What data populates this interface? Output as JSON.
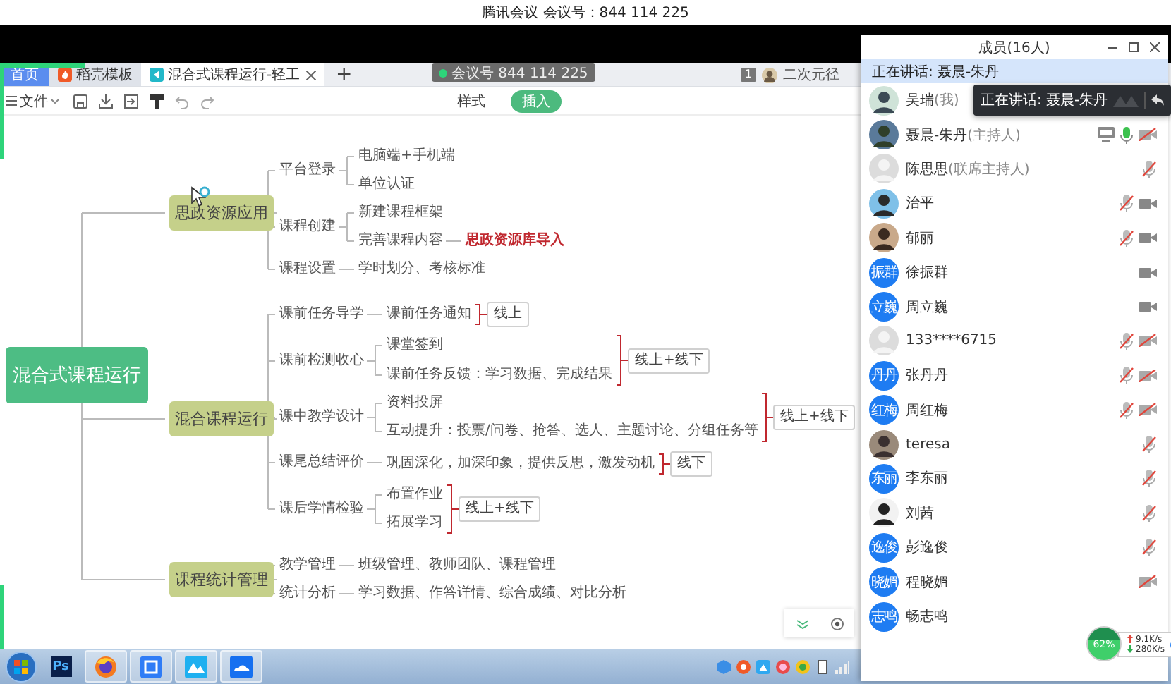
{
  "meeting_bar": {
    "title": "腾讯会议 会议号：844 114 225"
  },
  "meeting_badge": {
    "text": "会议号 844 114 225"
  },
  "tabs": [
    {
      "label": "首页",
      "selected": false,
      "kind": "home"
    },
    {
      "label": "稻壳模板",
      "selected": false,
      "kind": "template"
    },
    {
      "label": "混合式课程运行-轻工",
      "selected": true,
      "kind": "document"
    }
  ],
  "new_tab": "+",
  "account": {
    "badge": "1",
    "name": "二次元径"
  },
  "toolbar": {
    "menu": "文件",
    "ribbon_tabs": [
      {
        "label": "样式",
        "selected": false
      },
      {
        "label": "插入",
        "selected": true
      }
    ]
  },
  "mind_map": {
    "root": {
      "text": "混合式课程运行",
      "children": [
        {
          "text": "思政资源应用",
          "children": [
            {
              "text": "平台登录",
              "children": [
                {
                  "text": "电脑端+手机端"
                },
                {
                  "text": "单位认证"
                }
              ]
            },
            {
              "text": "课程创建",
              "children": [
                {
                  "text": "新建课程框架"
                },
                {
                  "text": "完善课程内容",
                  "children": [
                    {
                      "text": "思政资源库导入",
                      "emphasis": true
                    }
                  ]
                }
              ]
            },
            {
              "text": "课程设置",
              "children": [
                {
                  "text": "学时划分、考核标准"
                }
              ]
            }
          ]
        },
        {
          "text": "混合课程运行",
          "children": [
            {
              "text": "课前任务导学",
              "summary": "线上",
              "children": [
                {
                  "text": "课前任务通知"
                }
              ]
            },
            {
              "text": "课前检测收心",
              "summary": "线上+线下",
              "children": [
                {
                  "text": "课堂签到"
                },
                {
                  "text": "课前任务反馈：学习数据、完成结果"
                }
              ]
            },
            {
              "text": "课中教学设计",
              "summary": "线上+线下",
              "children": [
                {
                  "text": "资料投屏"
                },
                {
                  "text": "互动提升：投票/问卷、抢答、选人、主题讨论、分组任务等"
                }
              ]
            },
            {
              "text": "课尾总结评价",
              "summary": "线下",
              "children": [
                {
                  "text": "巩固深化，加深印象，提供反思，激发动机"
                }
              ]
            },
            {
              "text": "课后学情检验",
              "summary": "线上+线下",
              "children": [
                {
                  "text": "布置作业"
                },
                {
                  "text": "拓展学习"
                }
              ]
            }
          ]
        },
        {
          "text": "课程统计管理",
          "children": [
            {
              "text": "教学管理",
              "children": [
                {
                  "text": "班级管理、教师团队、课程管理"
                }
              ]
            },
            {
              "text": "统计分析",
              "children": [
                {
                  "text": "学习数据、作答详情、综合成绩、对比分析"
                }
              ]
            }
          ]
        }
      ]
    }
  },
  "members_panel": {
    "title": "成员(16人)",
    "speaking": "正在讲话: 聂晨-朱丹",
    "toast": "正在讲话: 聂晨-朱丹",
    "members": [
      {
        "name": "吴瑞",
        "role": "(我)",
        "avatar": {
          "kind": "photo"
        },
        "sharing": false
      },
      {
        "name": "聂晨-朱丹",
        "role": "(主持人)",
        "avatar": {
          "kind": "photo"
        },
        "sharing": true,
        "mic_on": true,
        "camera_on": false
      },
      {
        "name": "陈思思",
        "role": "(联席主持人)",
        "avatar": {
          "kind": "default"
        },
        "sharing": false,
        "mic_on": false
      },
      {
        "name": "治平",
        "avatar": {
          "kind": "photo"
        },
        "sharing": false,
        "mic_on": false,
        "camera_on": true
      },
      {
        "name": "郁丽",
        "avatar": {
          "kind": "photo"
        },
        "sharing": false,
        "mic_on": false,
        "camera_on": true
      },
      {
        "name": "徐振群",
        "avatar": {
          "kind": "initials",
          "text": "振群"
        },
        "sharing": false,
        "camera_on": true
      },
      {
        "name": "周立巍",
        "avatar": {
          "kind": "initials",
          "text": "立巍"
        },
        "sharing": false,
        "camera_on": true
      },
      {
        "name": "133****6715",
        "avatar": {
          "kind": "default"
        },
        "sharing": false,
        "mic_on": false,
        "camera_on": false
      },
      {
        "name": "张丹丹",
        "avatar": {
          "kind": "initials",
          "text": "丹丹"
        },
        "sharing": false,
        "mic_on": false,
        "camera_on": false
      },
      {
        "name": "周红梅",
        "avatar": {
          "kind": "initials",
          "text": "红梅"
        },
        "sharing": false,
        "mic_on": false,
        "camera_on": false
      },
      {
        "name": "teresa",
        "avatar": {
          "kind": "photo"
        },
        "sharing": false,
        "mic_on": false
      },
      {
        "name": "李东丽",
        "avatar": {
          "kind": "initials",
          "text": "东丽"
        },
        "sharing": false,
        "mic_on": false
      },
      {
        "name": "刘茜",
        "avatar": {
          "kind": "photo"
        },
        "sharing": false,
        "mic_on": false
      },
      {
        "name": "彭逸俊",
        "avatar": {
          "kind": "initials",
          "text": "逸俊"
        },
        "sharing": false,
        "mic_on": false
      },
      {
        "name": "程晓媚",
        "avatar": {
          "kind": "initials",
          "text": "晓媚"
        },
        "sharing": false,
        "camera_on": false
      },
      {
        "name": "畅志鸣",
        "avatar": {
          "kind": "initials",
          "text": "志鸣"
        },
        "sharing": false
      }
    ]
  },
  "network": {
    "usage": "62%",
    "upload": "9.1K/s",
    "download": "280K/s"
  },
  "taskbar": {
    "apps": [
      {
        "kind": "letters",
        "label": "Ps",
        "running": false
      },
      {
        "kind": "globe",
        "running": true
      },
      {
        "kind": "document",
        "running": true
      },
      {
        "kind": "mountains",
        "running": true
      },
      {
        "kind": "cloud",
        "running": true
      }
    ]
  }
}
